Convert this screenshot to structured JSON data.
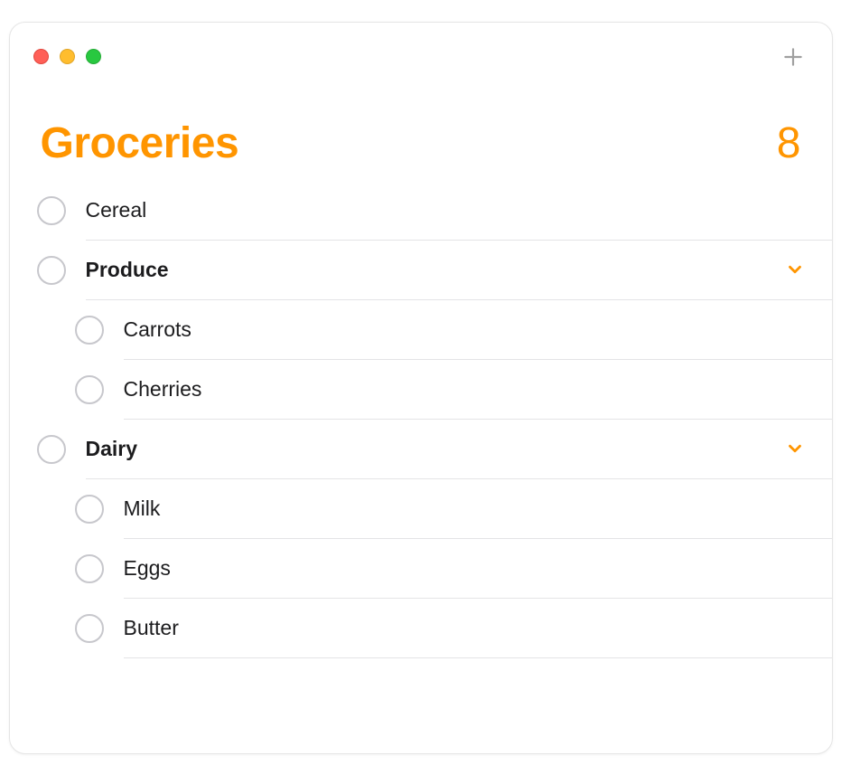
{
  "accent_color": "#ff9500",
  "header": {
    "title": "Groceries",
    "count": "8"
  },
  "items": [
    {
      "label": "Cereal",
      "bold": false,
      "indent": 0,
      "chevron": false
    },
    {
      "label": "Produce",
      "bold": true,
      "indent": 0,
      "chevron": true
    },
    {
      "label": "Carrots",
      "bold": false,
      "indent": 1,
      "chevron": false
    },
    {
      "label": "Cherries",
      "bold": false,
      "indent": 1,
      "chevron": false
    },
    {
      "label": "Dairy",
      "bold": true,
      "indent": 0,
      "chevron": true
    },
    {
      "label": "Milk",
      "bold": false,
      "indent": 1,
      "chevron": false
    },
    {
      "label": "Eggs",
      "bold": false,
      "indent": 1,
      "chevron": false
    },
    {
      "label": "Butter",
      "bold": false,
      "indent": 1,
      "chevron": false
    }
  ]
}
